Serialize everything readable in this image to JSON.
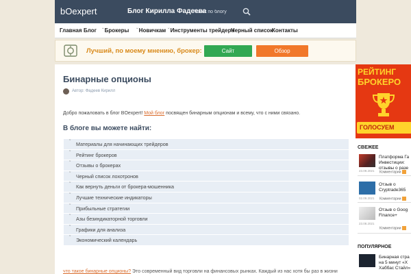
{
  "header": {
    "logo": "bOexpert",
    "blog_title": "Блог Кирилла Фадеева",
    "search_placeholder": "Поиск по блогу"
  },
  "nav": {
    "items": [
      {
        "label": "Главная",
        "caret": ""
      },
      {
        "label": "Блог",
        "caret": ""
      },
      {
        "label": "Брокеры",
        "caret": "ˇ"
      },
      {
        "label": "Новичкам",
        "caret": "ˇ"
      },
      {
        "label": "Инструменты трейдера",
        "caret": "ˇ"
      },
      {
        "label": "Черный список",
        "caret": ""
      },
      {
        "label": "Контакты",
        "caret": ""
      }
    ]
  },
  "promo": {
    "text": "Лучший, по моему мнению, брокер:",
    "site_button": "Сайт",
    "review_button": "Обзор"
  },
  "main": {
    "title": "Бинарные опционы",
    "author": "Автор: Фадеев Кирилл",
    "intro_before": "Добро пожаловать в блог BOexpert! ",
    "intro_link": "Мой блог",
    "intro_after": " посвящен бинарным опционам и всему, что с ними связано.",
    "find_heading": "В блоге вы можете найти:",
    "list_items": [
      "Материалы для начинающих трейдеров",
      "Рейтинг брокеров",
      "Отзывы о брокерах",
      "Черный список лохотронов",
      "Как вернуть деньги от брокера-мошенника",
      "Лучшие технические индикаторы",
      "Прибыльные стратегии",
      "Азы безиндикаторной торговли",
      "Графики для анализа",
      "Экономический календарь"
    ],
    "bottom_link": "что такое бинарные опционы?",
    "bottom_text": " Это современный вид торговли на финансовых рынках. Каждый из нас хотя бы раз в жизни"
  },
  "sidebar": {
    "banner_line1": "РЕЙТИНГ",
    "banner_line2": "БРОКЕРО",
    "vote_button": "ГОЛОСУЕМ",
    "fresh_heading": "СВЕЖЕЕ",
    "popular_heading": "ПОПУЛЯРНОЕ",
    "fresh": [
      {
        "title1": "Платформа Га",
        "title2": "Инвестиции:",
        "title3": "отзывы о разе",
        "date": "23.09.2021",
        "comments": "Комментарии"
      },
      {
        "title1": "Отзыв о",
        "title2": "Cryptrade365",
        "title3": "",
        "date": "02.09.2021",
        "comments": "Комментарии"
      },
      {
        "title1": "Отзыв о Goog",
        "title2": "Finance+",
        "title3": "",
        "date": "23.08.2021",
        "comments": "Комментарии"
      }
    ],
    "popular": [
      {
        "title1": "Бинарная стра",
        "title2": "на 5 минут «Х",
        "title3": "Хаббас Стайл»"
      }
    ]
  }
}
